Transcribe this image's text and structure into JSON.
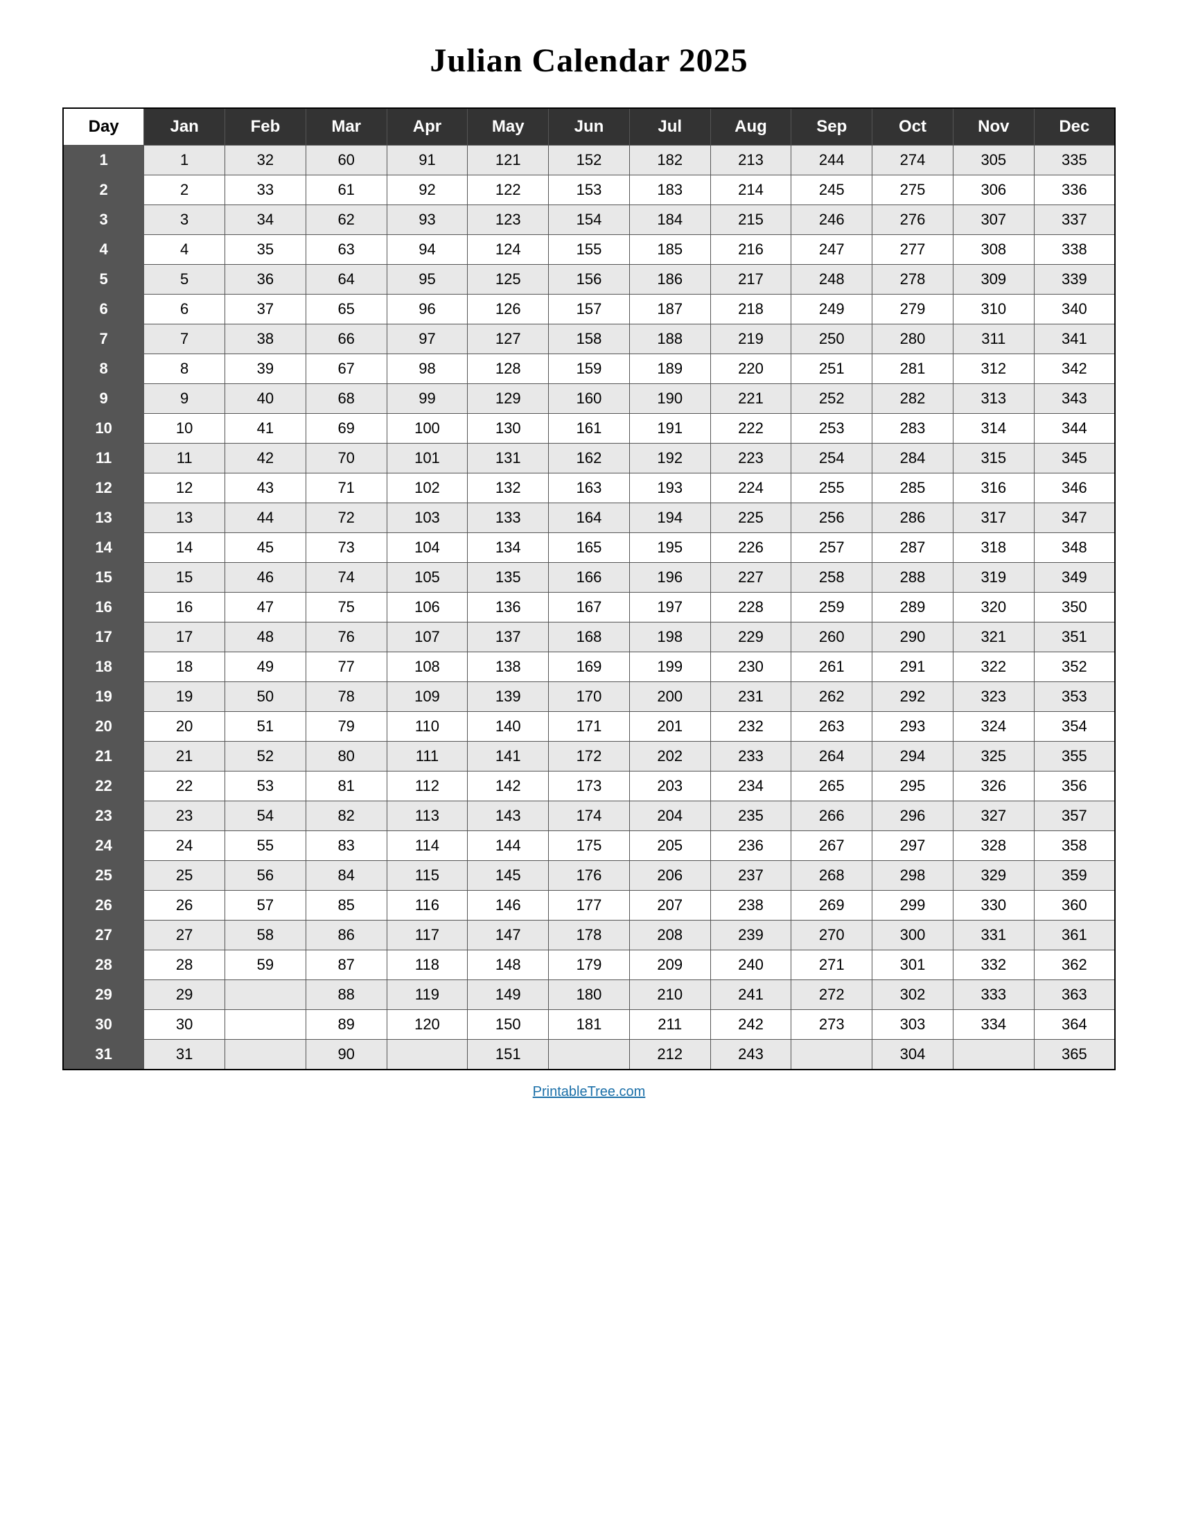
{
  "title": "Julian Calendar 2025",
  "footer": "PrintableTree.com",
  "headers": [
    "Day",
    "Jan",
    "Feb",
    "Mar",
    "Apr",
    "May",
    "Jun",
    "Jul",
    "Aug",
    "Sep",
    "Oct",
    "Nov",
    "Dec"
  ],
  "rows": [
    {
      "day": 1,
      "jan": 1,
      "feb": 32,
      "mar": 60,
      "apr": 91,
      "may": 121,
      "jun": 152,
      "jul": 182,
      "aug": 213,
      "sep": 244,
      "oct": 274,
      "nov": 305,
      "dec": 335
    },
    {
      "day": 2,
      "jan": 2,
      "feb": 33,
      "mar": 61,
      "apr": 92,
      "may": 122,
      "jun": 153,
      "jul": 183,
      "aug": 214,
      "sep": 245,
      "oct": 275,
      "nov": 306,
      "dec": 336
    },
    {
      "day": 3,
      "jan": 3,
      "feb": 34,
      "mar": 62,
      "apr": 93,
      "may": 123,
      "jun": 154,
      "jul": 184,
      "aug": 215,
      "sep": 246,
      "oct": 276,
      "nov": 307,
      "dec": 337
    },
    {
      "day": 4,
      "jan": 4,
      "feb": 35,
      "mar": 63,
      "apr": 94,
      "may": 124,
      "jun": 155,
      "jul": 185,
      "aug": 216,
      "sep": 247,
      "oct": 277,
      "nov": 308,
      "dec": 338
    },
    {
      "day": 5,
      "jan": 5,
      "feb": 36,
      "mar": 64,
      "apr": 95,
      "may": 125,
      "jun": 156,
      "jul": 186,
      "aug": 217,
      "sep": 248,
      "oct": 278,
      "nov": 309,
      "dec": 339
    },
    {
      "day": 6,
      "jan": 6,
      "feb": 37,
      "mar": 65,
      "apr": 96,
      "may": 126,
      "jun": 157,
      "jul": 187,
      "aug": 218,
      "sep": 249,
      "oct": 279,
      "nov": 310,
      "dec": 340
    },
    {
      "day": 7,
      "jan": 7,
      "feb": 38,
      "mar": 66,
      "apr": 97,
      "may": 127,
      "jun": 158,
      "jul": 188,
      "aug": 219,
      "sep": 250,
      "oct": 280,
      "nov": 311,
      "dec": 341
    },
    {
      "day": 8,
      "jan": 8,
      "feb": 39,
      "mar": 67,
      "apr": 98,
      "may": 128,
      "jun": 159,
      "jul": 189,
      "aug": 220,
      "sep": 251,
      "oct": 281,
      "nov": 312,
      "dec": 342
    },
    {
      "day": 9,
      "jan": 9,
      "feb": 40,
      "mar": 68,
      "apr": 99,
      "may": 129,
      "jun": 160,
      "jul": 190,
      "aug": 221,
      "sep": 252,
      "oct": 282,
      "nov": 313,
      "dec": 343
    },
    {
      "day": 10,
      "jan": 10,
      "feb": 41,
      "mar": 69,
      "apr": 100,
      "may": 130,
      "jun": 161,
      "jul": 191,
      "aug": 222,
      "sep": 253,
      "oct": 283,
      "nov": 314,
      "dec": 344
    },
    {
      "day": 11,
      "jan": 11,
      "feb": 42,
      "mar": 70,
      "apr": 101,
      "may": 131,
      "jun": 162,
      "jul": 192,
      "aug": 223,
      "sep": 254,
      "oct": 284,
      "nov": 315,
      "dec": 345
    },
    {
      "day": 12,
      "jan": 12,
      "feb": 43,
      "mar": 71,
      "apr": 102,
      "may": 132,
      "jun": 163,
      "jul": 193,
      "aug": 224,
      "sep": 255,
      "oct": 285,
      "nov": 316,
      "dec": 346
    },
    {
      "day": 13,
      "jan": 13,
      "feb": 44,
      "mar": 72,
      "apr": 103,
      "may": 133,
      "jun": 164,
      "jul": 194,
      "aug": 225,
      "sep": 256,
      "oct": 286,
      "nov": 317,
      "dec": 347
    },
    {
      "day": 14,
      "jan": 14,
      "feb": 45,
      "mar": 73,
      "apr": 104,
      "may": 134,
      "jun": 165,
      "jul": 195,
      "aug": 226,
      "sep": 257,
      "oct": 287,
      "nov": 318,
      "dec": 348
    },
    {
      "day": 15,
      "jan": 15,
      "feb": 46,
      "mar": 74,
      "apr": 105,
      "may": 135,
      "jun": 166,
      "jul": 196,
      "aug": 227,
      "sep": 258,
      "oct": 288,
      "nov": 319,
      "dec": 349
    },
    {
      "day": 16,
      "jan": 16,
      "feb": 47,
      "mar": 75,
      "apr": 106,
      "may": 136,
      "jun": 167,
      "jul": 197,
      "aug": 228,
      "sep": 259,
      "oct": 289,
      "nov": 320,
      "dec": 350
    },
    {
      "day": 17,
      "jan": 17,
      "feb": 48,
      "mar": 76,
      "apr": 107,
      "may": 137,
      "jun": 168,
      "jul": 198,
      "aug": 229,
      "sep": 260,
      "oct": 290,
      "nov": 321,
      "dec": 351
    },
    {
      "day": 18,
      "jan": 18,
      "feb": 49,
      "mar": 77,
      "apr": 108,
      "may": 138,
      "jun": 169,
      "jul": 199,
      "aug": 230,
      "sep": 261,
      "oct": 291,
      "nov": 322,
      "dec": 352
    },
    {
      "day": 19,
      "jan": 19,
      "feb": 50,
      "mar": 78,
      "apr": 109,
      "may": 139,
      "jun": 170,
      "jul": 200,
      "aug": 231,
      "sep": 262,
      "oct": 292,
      "nov": 323,
      "dec": 353
    },
    {
      "day": 20,
      "jan": 20,
      "feb": 51,
      "mar": 79,
      "apr": 110,
      "may": 140,
      "jun": 171,
      "jul": 201,
      "aug": 232,
      "sep": 263,
      "oct": 293,
      "nov": 324,
      "dec": 354
    },
    {
      "day": 21,
      "jan": 21,
      "feb": 52,
      "mar": 80,
      "apr": 111,
      "may": 141,
      "jun": 172,
      "jul": 202,
      "aug": 233,
      "sep": 264,
      "oct": 294,
      "nov": 325,
      "dec": 355
    },
    {
      "day": 22,
      "jan": 22,
      "feb": 53,
      "mar": 81,
      "apr": 112,
      "may": 142,
      "jun": 173,
      "jul": 203,
      "aug": 234,
      "sep": 265,
      "oct": 295,
      "nov": 326,
      "dec": 356
    },
    {
      "day": 23,
      "jan": 23,
      "feb": 54,
      "mar": 82,
      "apr": 113,
      "may": 143,
      "jun": 174,
      "jul": 204,
      "aug": 235,
      "sep": 266,
      "oct": 296,
      "nov": 327,
      "dec": 357
    },
    {
      "day": 24,
      "jan": 24,
      "feb": 55,
      "mar": 83,
      "apr": 114,
      "may": 144,
      "jun": 175,
      "jul": 205,
      "aug": 236,
      "sep": 267,
      "oct": 297,
      "nov": 328,
      "dec": 358
    },
    {
      "day": 25,
      "jan": 25,
      "feb": 56,
      "mar": 84,
      "apr": 115,
      "may": 145,
      "jun": 176,
      "jul": 206,
      "aug": 237,
      "sep": 268,
      "oct": 298,
      "nov": 329,
      "dec": 359
    },
    {
      "day": 26,
      "jan": 26,
      "feb": 57,
      "mar": 85,
      "apr": 116,
      "may": 146,
      "jun": 177,
      "jul": 207,
      "aug": 238,
      "sep": 269,
      "oct": 299,
      "nov": 330,
      "dec": 360
    },
    {
      "day": 27,
      "jan": 27,
      "feb": 58,
      "mar": 86,
      "apr": 117,
      "may": 147,
      "jun": 178,
      "jul": 208,
      "aug": 239,
      "sep": 270,
      "oct": 300,
      "nov": 331,
      "dec": 361
    },
    {
      "day": 28,
      "jan": 28,
      "feb": 59,
      "mar": 87,
      "apr": 118,
      "may": 148,
      "jun": 179,
      "jul": 209,
      "aug": 240,
      "sep": 271,
      "oct": 301,
      "nov": 332,
      "dec": 362
    },
    {
      "day": 29,
      "jan": 29,
      "feb": null,
      "mar": 88,
      "apr": 119,
      "may": 149,
      "jun": 180,
      "jul": 210,
      "aug": 241,
      "sep": 272,
      "oct": 302,
      "nov": 333,
      "dec": 363
    },
    {
      "day": 30,
      "jan": 30,
      "feb": null,
      "mar": 89,
      "apr": 120,
      "may": 150,
      "jun": 181,
      "jul": 211,
      "aug": 242,
      "sep": 273,
      "oct": 303,
      "nov": 334,
      "dec": 364
    },
    {
      "day": 31,
      "jan": 31,
      "feb": null,
      "mar": 90,
      "apr": null,
      "may": 151,
      "jun": null,
      "jul": 212,
      "aug": 243,
      "sep": null,
      "oct": 304,
      "nov": null,
      "dec": 365
    }
  ],
  "months": [
    "jan",
    "feb",
    "mar",
    "apr",
    "may",
    "jun",
    "jul",
    "aug",
    "sep",
    "oct",
    "nov",
    "dec"
  ]
}
